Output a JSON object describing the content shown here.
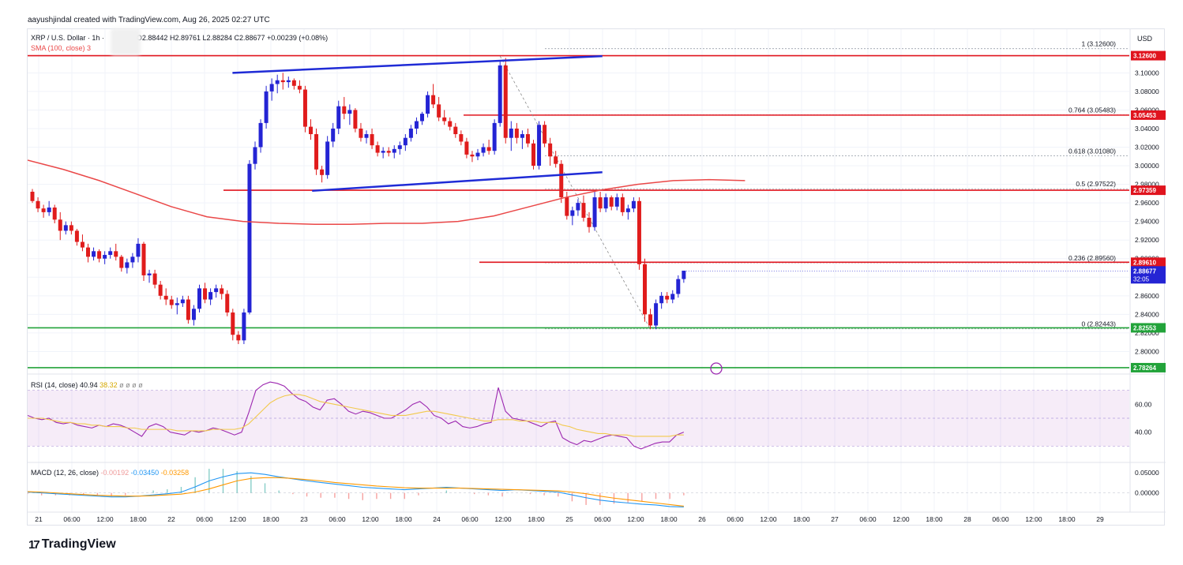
{
  "author_line": "aayushjindal created with TradingView.com, Aug 26, 2025 02:27 UTC",
  "logo_text": "TradingView",
  "header": {
    "symbol": "XRP / U.S. Dollar · 1h ·",
    "ohlc": "O2.88442  H2.89761  L2.88284  C2.88677  +0.00239 (+0.08%)",
    "sma_label": "SMA (100, close)",
    "sma_value": "3"
  },
  "currency": "USD",
  "colors": {
    "up": "#2424d4",
    "down": "#e01c1c",
    "sma": "#ea4848",
    "trendline": "#1f2bd6",
    "resistance": "#e0141e",
    "support": "#22a33a",
    "rsi": "#9c27b0",
    "rsi_ma": "#f2c94c",
    "macd": "#2196f3",
    "signal": "#ff9800"
  },
  "chart_data": [
    {
      "type": "candlestick",
      "title": "XRP / U.S. Dollar · 1h",
      "ylim": [
        2.78,
        3.13
      ],
      "y_ticks": [
        "3.10000",
        "3.08000",
        "3.06000",
        "3.04000",
        "3.02000",
        "3.00000",
        "2.98000",
        "2.96000",
        "2.94000",
        "2.92000",
        "2.90000",
        "2.88000",
        "2.86000",
        "2.84000",
        "2.82000",
        "2.80000"
      ],
      "x_ticks": [
        "21",
        "06:00",
        "12:00",
        "18:00",
        "22",
        "06:00",
        "12:00",
        "18:00",
        "23",
        "06:00",
        "12:00",
        "18:00",
        "24",
        "06:00",
        "12:00",
        "18:00",
        "25",
        "06:00",
        "12:00",
        "18:00",
        "26",
        "06:00",
        "12:00",
        "18:00",
        "27",
        "06:00",
        "12:00",
        "18:00",
        "28",
        "06:00",
        "12:00",
        "18:00",
        "29"
      ],
      "candles": [
        [
          2.972,
          2.975,
          2.96,
          2.962
        ],
        [
          2.962,
          2.966,
          2.95,
          2.954
        ],
        [
          2.954,
          2.958,
          2.944,
          2.95
        ],
        [
          2.95,
          2.962,
          2.946,
          2.955
        ],
        [
          2.955,
          2.958,
          2.938,
          2.942
        ],
        [
          2.942,
          2.95,
          2.92,
          2.93
        ],
        [
          2.93,
          2.94,
          2.926,
          2.936
        ],
        [
          2.936,
          2.94,
          2.926,
          2.93
        ],
        [
          2.93,
          2.932,
          2.914,
          2.918
        ],
        [
          2.918,
          2.926,
          2.908,
          2.912
        ],
        [
          2.912,
          2.916,
          2.896,
          2.902
        ],
        [
          2.902,
          2.912,
          2.898,
          2.908
        ],
        [
          2.908,
          2.91,
          2.896,
          2.9
        ],
        [
          2.9,
          2.908,
          2.894,
          2.904
        ],
        [
          2.904,
          2.912,
          2.9,
          2.908
        ],
        [
          2.908,
          2.916,
          2.898,
          2.902
        ],
        [
          2.902,
          2.904,
          2.886,
          2.89
        ],
        [
          2.89,
          2.9,
          2.884,
          2.896
        ],
        [
          2.896,
          2.906,
          2.89,
          2.902
        ],
        [
          2.902,
          2.922,
          2.896,
          2.916
        ],
        [
          2.916,
          2.918,
          2.876,
          2.882
        ],
        [
          2.882,
          2.888,
          2.874,
          2.884
        ],
        [
          2.884,
          2.888,
          2.868,
          2.872
        ],
        [
          2.872,
          2.876,
          2.856,
          2.86
        ],
        [
          2.86,
          2.868,
          2.85,
          2.856
        ],
        [
          2.856,
          2.86,
          2.846,
          2.85
        ],
        [
          2.85,
          2.858,
          2.84,
          2.852
        ],
        [
          2.852,
          2.86,
          2.848,
          2.856
        ],
        [
          2.856,
          2.86,
          2.83,
          2.834
        ],
        [
          2.834,
          2.85,
          2.828,
          2.846
        ],
        [
          2.846,
          2.872,
          2.842,
          2.868
        ],
        [
          2.868,
          2.874,
          2.852,
          2.856
        ],
        [
          2.856,
          2.868,
          2.85,
          2.864
        ],
        [
          2.864,
          2.872,
          2.858,
          2.868
        ],
        [
          2.868,
          2.872,
          2.856,
          2.862
        ],
        [
          2.862,
          2.866,
          2.838,
          2.842
        ],
        [
          2.842,
          2.846,
          2.812,
          2.818
        ],
        [
          2.818,
          2.822,
          2.808,
          2.812
        ],
        [
          2.812,
          2.846,
          2.808,
          2.842
        ],
        [
          2.842,
          3.006,
          2.84,
          3.002
        ],
        [
          3.002,
          3.026,
          2.996,
          3.02
        ],
        [
          3.02,
          3.05,
          3.014,
          3.046
        ],
        [
          3.046,
          3.086,
          3.04,
          3.08
        ],
        [
          3.08,
          3.094,
          3.07,
          3.088
        ],
        [
          3.088,
          3.098,
          3.078,
          3.092
        ],
        [
          3.092,
          3.1,
          3.082,
          3.09
        ],
        [
          3.09,
          3.096,
          3.084,
          3.092
        ],
        [
          3.092,
          3.094,
          3.082,
          3.086
        ],
        [
          3.086,
          3.092,
          3.078,
          3.082
        ],
        [
          3.082,
          3.086,
          3.036,
          3.042
        ],
        [
          3.042,
          3.05,
          3.028,
          3.034
        ],
        [
          3.034,
          3.04,
          2.99,
          2.996
        ],
        [
          2.996,
          3.0,
          2.982,
          2.99
        ],
        [
          2.99,
          3.032,
          2.986,
          3.026
        ],
        [
          3.026,
          3.046,
          3.02,
          3.04
        ],
        [
          3.04,
          3.07,
          3.034,
          3.064
        ],
        [
          3.064,
          3.074,
          3.05,
          3.056
        ],
        [
          3.056,
          3.066,
          3.044,
          3.06
        ],
        [
          3.06,
          3.062,
          3.036,
          3.04
        ],
        [
          3.04,
          3.046,
          3.026,
          3.03
        ],
        [
          3.03,
          3.038,
          3.024,
          3.034
        ],
        [
          3.034,
          3.04,
          3.018,
          3.022
        ],
        [
          3.022,
          3.026,
          3.01,
          3.014
        ],
        [
          3.014,
          3.02,
          3.008,
          3.016
        ],
        [
          3.016,
          3.02,
          3.01,
          3.014
        ],
        [
          3.014,
          3.022,
          3.008,
          3.018
        ],
        [
          3.018,
          3.026,
          3.012,
          3.022
        ],
        [
          3.022,
          3.034,
          3.016,
          3.03
        ],
        [
          3.03,
          3.044,
          3.026,
          3.04
        ],
        [
          3.04,
          3.052,
          3.034,
          3.048
        ],
        [
          3.048,
          3.058,
          3.044,
          3.056
        ],
        [
          3.056,
          3.08,
          3.052,
          3.076
        ],
        [
          3.076,
          3.088,
          3.062,
          3.066
        ],
        [
          3.066,
          3.074,
          3.048,
          3.052
        ],
        [
          3.052,
          3.06,
          3.044,
          3.048
        ],
        [
          3.048,
          3.052,
          3.038,
          3.042
        ],
        [
          3.042,
          3.046,
          3.03,
          3.034
        ],
        [
          3.034,
          3.038,
          3.022,
          3.026
        ],
        [
          3.026,
          3.03,
          3.008,
          3.012
        ],
        [
          3.012,
          3.016,
          3.004,
          3.01
        ],
        [
          3.01,
          3.018,
          3.006,
          3.014
        ],
        [
          3.014,
          3.024,
          3.01,
          3.02
        ],
        [
          3.02,
          3.028,
          3.012,
          3.016
        ],
        [
          3.016,
          3.05,
          3.012,
          3.046
        ],
        [
          3.046,
          3.112,
          3.042,
          3.108
        ],
        [
          3.108,
          3.116,
          3.024,
          3.03
        ],
        [
          3.03,
          3.048,
          3.016,
          3.04
        ],
        [
          3.04,
          3.046,
          3.024,
          3.03
        ],
        [
          3.03,
          3.038,
          3.018,
          3.034
        ],
        [
          3.034,
          3.04,
          3.02,
          3.024
        ],
        [
          3.024,
          3.028,
          2.996,
          3.0
        ],
        [
          3.0,
          3.048,
          2.996,
          3.044
        ],
        [
          3.044,
          3.048,
          3.02,
          3.024
        ],
        [
          3.024,
          3.03,
          3.0,
          3.01
        ],
        [
          3.01,
          3.016,
          2.998,
          3.002
        ],
        [
          3.002,
          3.006,
          2.96,
          2.966
        ],
        [
          2.966,
          2.972,
          2.942,
          2.946
        ],
        [
          2.946,
          2.956,
          2.936,
          2.952
        ],
        [
          2.952,
          2.964,
          2.946,
          2.96
        ],
        [
          2.96,
          2.968,
          2.94,
          2.944
        ],
        [
          2.944,
          2.95,
          2.928,
          2.934
        ],
        [
          2.934,
          2.972,
          2.93,
          2.966
        ],
        [
          2.966,
          2.972,
          2.95,
          2.954
        ],
        [
          2.954,
          2.97,
          2.95,
          2.966
        ],
        [
          2.966,
          2.968,
          2.952,
          2.956
        ],
        [
          2.956,
          2.97,
          2.952,
          2.966
        ],
        [
          2.966,
          2.97,
          2.946,
          2.95
        ],
        [
          2.95,
          2.958,
          2.942,
          2.954
        ],
        [
          2.954,
          2.966,
          2.95,
          2.962
        ],
        [
          2.962,
          2.966,
          2.888,
          2.894
        ],
        [
          2.894,
          2.9,
          2.832,
          2.84
        ],
        [
          2.84,
          2.846,
          2.824,
          2.828
        ],
        [
          2.828,
          2.856,
          2.824,
          2.852
        ],
        [
          2.852,
          2.864,
          2.846,
          2.86
        ],
        [
          2.86,
          2.864,
          2.852,
          2.856
        ],
        [
          2.856,
          2.866,
          2.852,
          2.862
        ],
        [
          2.862,
          2.882,
          2.858,
          2.878
        ],
        [
          2.878,
          2.884,
          2.874,
          2.887
        ]
      ],
      "sma_100": [
        3.006,
        2.996,
        2.984,
        2.97,
        2.956,
        2.945,
        2.94,
        2.938,
        2.937,
        2.937,
        2.938,
        2.938,
        2.94,
        2.946,
        2.956,
        2.966,
        2.974,
        2.98,
        2.984,
        2.985,
        2.984
      ],
      "trend_upper": {
        "from": [
          3.1,
          0.18
        ],
        "to": [
          3.118,
          0.505
        ]
      },
      "trend_lower": {
        "from": [
          2.973,
          0.25
        ],
        "to": [
          2.993,
          0.505
        ]
      },
      "horizontal_levels": [
        {
          "value": 3.1185,
          "label": "3.12600",
          "color": "resistance"
        },
        {
          "value": 3.0545,
          "label": "3.05453",
          "color": "resistance"
        },
        {
          "value": 2.9736,
          "label": "2.97359",
          "color": "resistance"
        },
        {
          "value": 2.8961,
          "label": "2.89610",
          "color": "resistance"
        },
        {
          "value": 2.8255,
          "label": "2.82553",
          "color": "support"
        },
        {
          "value": 2.7826,
          "label": "2.78264",
          "color": "support"
        }
      ],
      "fib_levels": [
        {
          "ratio": "1",
          "value": "(3.12600)",
          "price": 3.126
        },
        {
          "ratio": "0.764",
          "value": "(3.05483)",
          "price": 3.0548
        },
        {
          "ratio": "0.618",
          "value": "(3.01080)",
          "price": 3.0108
        },
        {
          "ratio": "0.5",
          "value": "(2.97522)",
          "price": 2.9752
        },
        {
          "ratio": "0.236",
          "value": "(2.89560)",
          "price": 2.8956
        },
        {
          "ratio": "0",
          "value": "(2.82443)",
          "price": 2.8244
        }
      ],
      "current_price": {
        "value": "2.88677",
        "countdown": "32:05",
        "price": 2.88677
      }
    },
    {
      "type": "line",
      "title": "RSI (14, close)",
      "values_text": [
        "40.94",
        "38.32",
        "ø",
        "ø",
        "ø",
        "ø"
      ],
      "y_ticks": [
        "60.00",
        "40.00"
      ],
      "ylim": [
        20,
        80
      ],
      "band": [
        30,
        70
      ],
      "series": [
        {
          "name": "RSI",
          "values": [
            52,
            50,
            49,
            50,
            47,
            46,
            47,
            45,
            44,
            43,
            45,
            44,
            46,
            45,
            43,
            40,
            37,
            44,
            46,
            44,
            40,
            39,
            38,
            41,
            40,
            41,
            43,
            42,
            40,
            38,
            40,
            54,
            70,
            74,
            76,
            75,
            73,
            68,
            64,
            62,
            58,
            56,
            63,
            64,
            60,
            55,
            53,
            55,
            54,
            52,
            50,
            50,
            53,
            56,
            60,
            62,
            58,
            52,
            50,
            46,
            48,
            44,
            43,
            44,
            46,
            47,
            72,
            55,
            50,
            49,
            48,
            46,
            44,
            47,
            48,
            36,
            33,
            31,
            34,
            33,
            35,
            37,
            38,
            37,
            36,
            30,
            28,
            30,
            32,
            33,
            33,
            38,
            40
          ]
        },
        {
          "name": "MA",
          "values": [
            50,
            50,
            50,
            49,
            48,
            47,
            47,
            46,
            46,
            45,
            45,
            44,
            44,
            44,
            43,
            43,
            42,
            42,
            42,
            42,
            42,
            41,
            41,
            41,
            41,
            41,
            42,
            42,
            42,
            42,
            43,
            46,
            51,
            56,
            61,
            64,
            66,
            67,
            67,
            66,
            64,
            62,
            61,
            60,
            59,
            58,
            57,
            56,
            55,
            54,
            53,
            52,
            52,
            52,
            53,
            54,
            55,
            55,
            54,
            53,
            52,
            51,
            50,
            49,
            48,
            48,
            49,
            49,
            49,
            48,
            48,
            48,
            47,
            47,
            47,
            45,
            44,
            42,
            41,
            40,
            39,
            39,
            38,
            38,
            38,
            37,
            37,
            37,
            37,
            37,
            37,
            38,
            38
          ]
        }
      ]
    },
    {
      "type": "line",
      "title": "MACD (12, 26, close)",
      "values_text": [
        "-0.00192",
        "-0.03450",
        "-0.03258"
      ],
      "y_ticks": [
        "0.05000",
        "0.00000"
      ],
      "ylim": [
        -0.04,
        0.07
      ],
      "series": [
        {
          "name": "MACD",
          "values": [
            0.002,
            0.0,
            -0.002,
            -0.004,
            -0.006,
            -0.008,
            -0.01,
            -0.01,
            -0.008,
            -0.005,
            -0.002,
            0.002,
            0.015,
            0.03,
            0.04,
            0.048,
            0.05,
            0.046,
            0.04,
            0.035,
            0.03,
            0.026,
            0.022,
            0.018,
            0.014,
            0.012,
            0.01,
            0.008,
            0.01,
            0.012,
            0.014,
            0.012,
            0.01,
            0.008,
            0.006,
            0.008,
            0.006,
            0.004,
            0.002,
            -0.005,
            -0.012,
            -0.018,
            -0.022,
            -0.025,
            -0.028,
            -0.03,
            -0.034,
            -0.035
          ]
        },
        {
          "name": "Signal",
          "values": [
            0.003,
            0.002,
            0.0,
            -0.002,
            -0.004,
            -0.006,
            -0.007,
            -0.008,
            -0.008,
            -0.007,
            -0.005,
            -0.003,
            0.002,
            0.01,
            0.02,
            0.03,
            0.036,
            0.038,
            0.038,
            0.036,
            0.033,
            0.03,
            0.026,
            0.023,
            0.02,
            0.017,
            0.015,
            0.013,
            0.012,
            0.012,
            0.012,
            0.012,
            0.011,
            0.01,
            0.009,
            0.008,
            0.007,
            0.006,
            0.005,
            0.002,
            -0.002,
            -0.008,
            -0.013,
            -0.017,
            -0.021,
            -0.025,
            -0.029,
            -0.033
          ]
        }
      ]
    }
  ]
}
